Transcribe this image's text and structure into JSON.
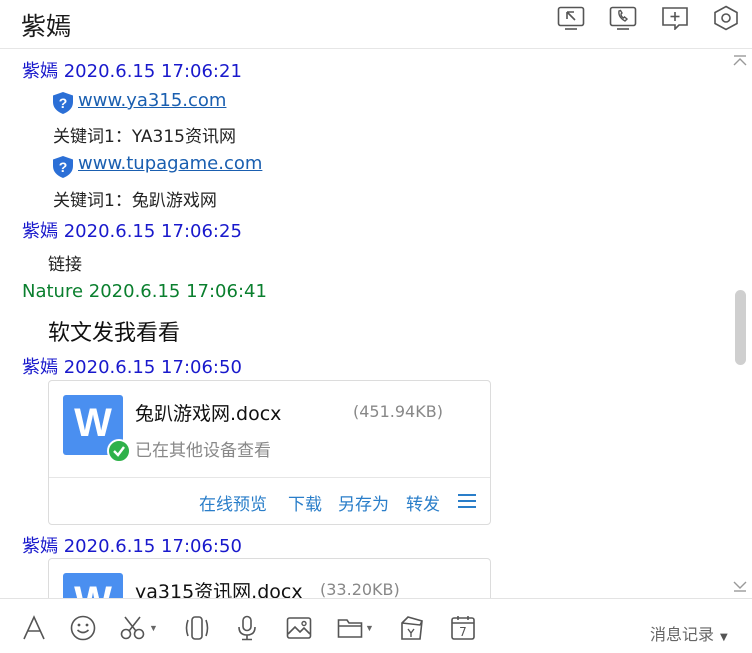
{
  "header": {
    "title": "紫嫣",
    "buttons": [
      {
        "name": "screen-share-icon"
      },
      {
        "name": "phone-icon"
      },
      {
        "name": "add-chat-icon"
      },
      {
        "name": "settings-icon"
      }
    ]
  },
  "messages": {
    "m1": {
      "meta": "紫嫣 2020.6.15 17:06:21",
      "link1": "www.ya315.com",
      "kw1": "关键词1：YA315资讯网",
      "link2": "www.tupagame.com",
      "kw2": "关键词1：兔趴游戏网"
    },
    "m2": {
      "meta": "紫嫣 2020.6.15 17:06:25",
      "text": "链接"
    },
    "m3": {
      "meta": "Nature 2020.6.15 17:06:41",
      "text": "软文发我看看"
    },
    "m4": {
      "meta": "紫嫣 2020.6.15 17:06:50",
      "file": {
        "icon_letter": "W",
        "name": "兔趴游戏网.docx",
        "size": "(451.94KB)",
        "status": "已在其他设备查看",
        "actions": [
          "在线预览",
          "下载",
          "另存为",
          "转发"
        ]
      }
    },
    "m5": {
      "meta": "紫嫣 2020.6.15 17:06:50",
      "file": {
        "icon_letter": "W",
        "name": "ya315资讯网.docx",
        "size": "(33.20KB)"
      }
    }
  },
  "toolbar": {
    "icons": [
      "font-icon",
      "emoji-icon",
      "scissors-icon",
      "shake-icon",
      "microphone-icon",
      "image-icon",
      "folder-icon",
      "red-packet-icon",
      "calendar-icon"
    ],
    "calendar_day": "7",
    "history_label": "消息记录"
  },
  "colors": {
    "self_name": "#1919cc",
    "other_name": "#0a7f2e",
    "link": "#1a5fb0",
    "action": "#2a7ec9",
    "file_icon": "#4a8ff0"
  }
}
